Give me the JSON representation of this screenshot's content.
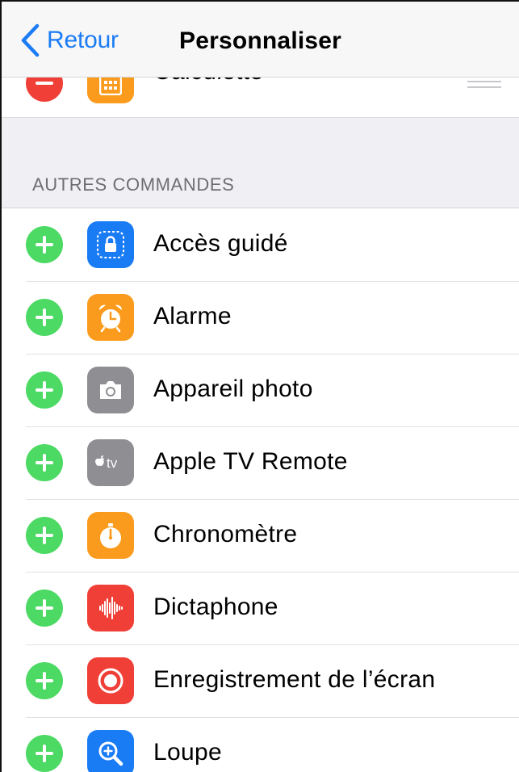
{
  "navbar": {
    "back_label": "Retour",
    "title": "Personnaliser"
  },
  "included": {
    "partial_item": {
      "label": "Calculette",
      "icon": "calculator-icon",
      "color": "#fb9b1d"
    }
  },
  "section": {
    "header": "AUTRES COMMANDES"
  },
  "controls": [
    {
      "label": "Accès guidé",
      "icon": "guided-access-icon",
      "color": "#1a7cf5"
    },
    {
      "label": "Alarme",
      "icon": "alarm-clock-icon",
      "color": "#fb9b1d"
    },
    {
      "label": "Appareil photo",
      "icon": "camera-icon",
      "color": "#8e8e93"
    },
    {
      "label": "Apple TV Remote",
      "icon": "apple-tv-icon",
      "color": "#8e8e93"
    },
    {
      "label": "Chronomètre",
      "icon": "stopwatch-icon",
      "color": "#fb9b1d"
    },
    {
      "label": "Dictaphone",
      "icon": "voice-memo-icon",
      "color": "#f03f37"
    },
    {
      "label": "Enregistrement de l’écran",
      "icon": "screen-recording-icon",
      "color": "#f03f37"
    },
    {
      "label": "Loupe",
      "icon": "magnifier-icon",
      "color": "#1a7cf5"
    }
  ],
  "colors": {
    "add_button": "#4cd964",
    "remove_button": "#f03f37",
    "link_blue": "#1b7cf5",
    "section_background": "#efeff4"
  }
}
